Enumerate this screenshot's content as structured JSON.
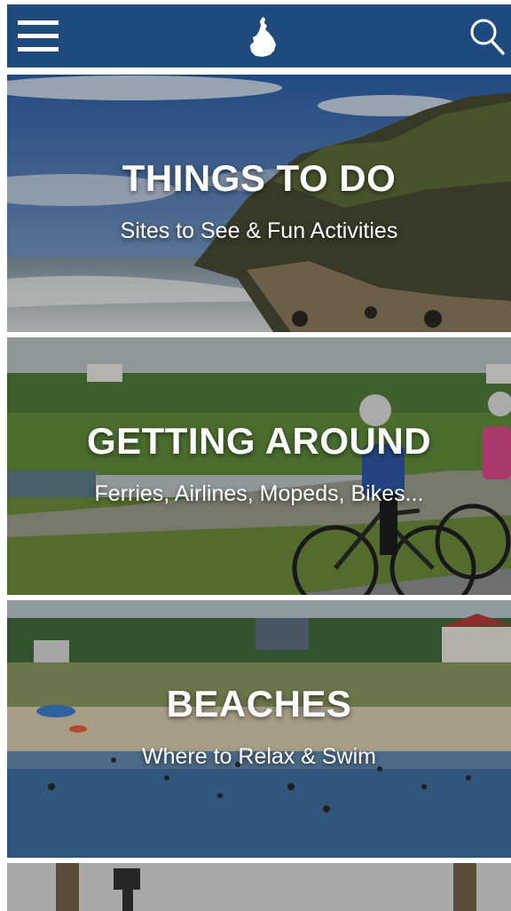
{
  "header": {
    "menu_icon": "hamburger-menu-icon",
    "logo": "block-island-logo",
    "search_icon": "search-icon",
    "bg_color": "#1f4a7d"
  },
  "cards": [
    {
      "title": "THINGS TO DO",
      "subtitle": "Sites to See & Fun Activities"
    },
    {
      "title": "GETTING AROUND",
      "subtitle": "Ferries, Airlines, Mopeds, Bikes..."
    },
    {
      "title": "BEACHES",
      "subtitle": "Where to Relax & Swim"
    },
    {
      "title": "",
      "subtitle": ""
    }
  ]
}
